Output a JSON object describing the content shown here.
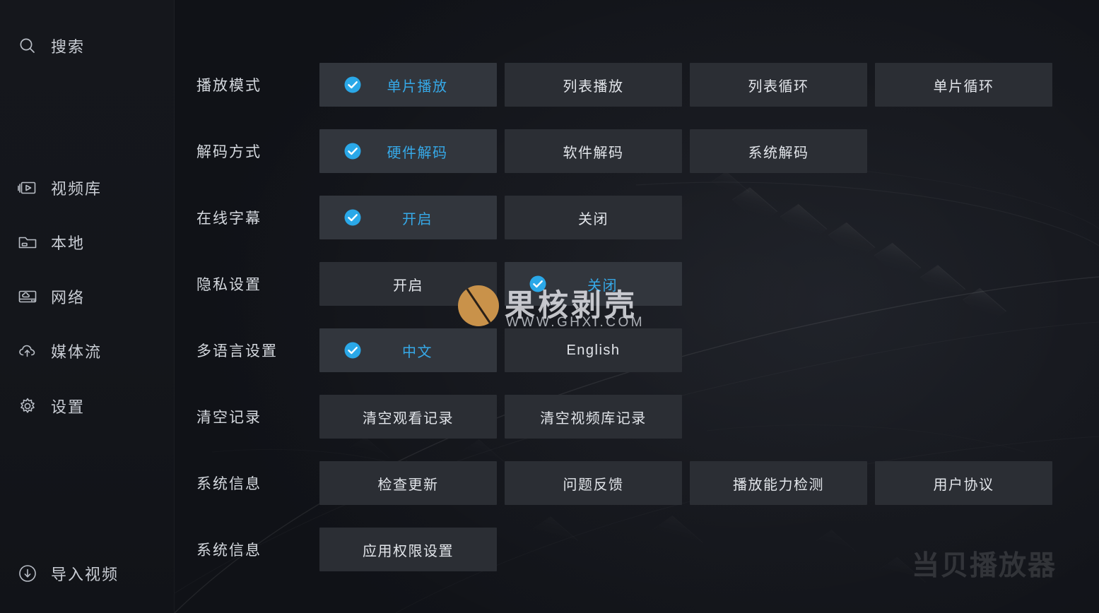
{
  "app": {
    "brand_watermark": "当贝播放器",
    "accent_color": "#36a9e8",
    "panel_color": "#2b2e34",
    "background_color": "#121419"
  },
  "watermark": {
    "logo_icon": "coffee-bean-logo",
    "title": "果核剥壳",
    "url": "WWW.GHXI.COM",
    "logo_color": "#c9924a"
  },
  "sidebar": {
    "search": {
      "icon": "search-icon",
      "label": "搜索"
    },
    "items": [
      {
        "icon": "video-library-icon",
        "label": "视频库"
      },
      {
        "icon": "folder-icon",
        "label": "本地"
      },
      {
        "icon": "network-icon",
        "label": "网络"
      },
      {
        "icon": "cloud-upload-icon",
        "label": "媒体流"
      },
      {
        "icon": "gear-icon",
        "label": "设置"
      }
    ],
    "footer": {
      "icon": "download-circle-icon",
      "label": "导入视频"
    }
  },
  "settings": {
    "rows": [
      {
        "label": "播放模式",
        "options": [
          {
            "label": "单片播放",
            "selected": true
          },
          {
            "label": "列表播放",
            "selected": false
          },
          {
            "label": "列表循环",
            "selected": false
          },
          {
            "label": "单片循环",
            "selected": false
          }
        ]
      },
      {
        "label": "解码方式",
        "options": [
          {
            "label": "硬件解码",
            "selected": true
          },
          {
            "label": "软件解码",
            "selected": false
          },
          {
            "label": "系统解码",
            "selected": false
          }
        ]
      },
      {
        "label": "在线字幕",
        "options": [
          {
            "label": "开启",
            "selected": true
          },
          {
            "label": "关闭",
            "selected": false
          }
        ]
      },
      {
        "label": "隐私设置",
        "options": [
          {
            "label": "开启",
            "selected": false
          },
          {
            "label": "关闭",
            "selected": true
          }
        ]
      },
      {
        "label": "多语言设置",
        "options": [
          {
            "label": "中文",
            "selected": true
          },
          {
            "label": "English",
            "selected": false
          }
        ]
      },
      {
        "label": "清空记录",
        "options": [
          {
            "label": "清空观看记录",
            "selected": false
          },
          {
            "label": "清空视频库记录",
            "selected": false
          }
        ]
      },
      {
        "label": "系统信息",
        "options": [
          {
            "label": "检查更新",
            "selected": false
          },
          {
            "label": "问题反馈",
            "selected": false
          },
          {
            "label": "播放能力检测",
            "selected": false
          },
          {
            "label": "用户协议",
            "selected": false
          }
        ]
      },
      {
        "label": "系统信息",
        "options": [
          {
            "label": "应用权限设置",
            "selected": false
          }
        ]
      }
    ]
  }
}
